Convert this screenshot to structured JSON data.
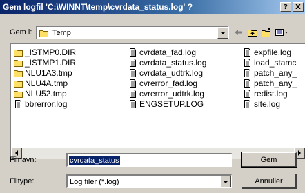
{
  "dialog": {
    "title": "Gem logfil 'C:\\WINNT\\temp\\cvrdata_status.log' ?",
    "help_glyph": "?",
    "close_glyph": "X"
  },
  "location": {
    "label": "Gem i:",
    "value": "Temp",
    "toolbar_icons": [
      "back-arrow-icon",
      "up-folder-icon",
      "new-folder-icon",
      "view-menu-icon"
    ]
  },
  "file_list": {
    "columns": [
      [
        {
          "name": "_ISTMP0.DIR",
          "type": "folder"
        },
        {
          "name": "_ISTMP1.DIR",
          "type": "folder"
        },
        {
          "name": "NLU1A3.tmp",
          "type": "folder"
        },
        {
          "name": "NLU4A.tmp",
          "type": "folder"
        },
        {
          "name": "NLU52.tmp",
          "type": "folder"
        },
        {
          "name": "bbrerror.log",
          "type": "file"
        }
      ],
      [
        {
          "name": "cvrdata_fad.log",
          "type": "file"
        },
        {
          "name": "cvrdata_status.log",
          "type": "file"
        },
        {
          "name": "cvrdata_udtrk.log",
          "type": "file"
        },
        {
          "name": "cvrerror_fad.log",
          "type": "file"
        },
        {
          "name": "cvrerror_udtrk.log",
          "type": "file"
        },
        {
          "name": "ENGSETUP.LOG",
          "type": "file"
        }
      ],
      [
        {
          "name": "expfile.log",
          "type": "file"
        },
        {
          "name": "load_stamc",
          "type": "file"
        },
        {
          "name": "patch_any_",
          "type": "file"
        },
        {
          "name": "patch_any_",
          "type": "file"
        },
        {
          "name": "redist.log",
          "type": "file"
        },
        {
          "name": "site.log",
          "type": "file"
        }
      ]
    ]
  },
  "filename": {
    "label": "Filnavn:",
    "value": "cvrdata_status"
  },
  "filetype": {
    "label": "Filtype:",
    "value": "Log filer (*.log)"
  },
  "buttons": {
    "save": "Gem",
    "cancel": "Annuller"
  }
}
